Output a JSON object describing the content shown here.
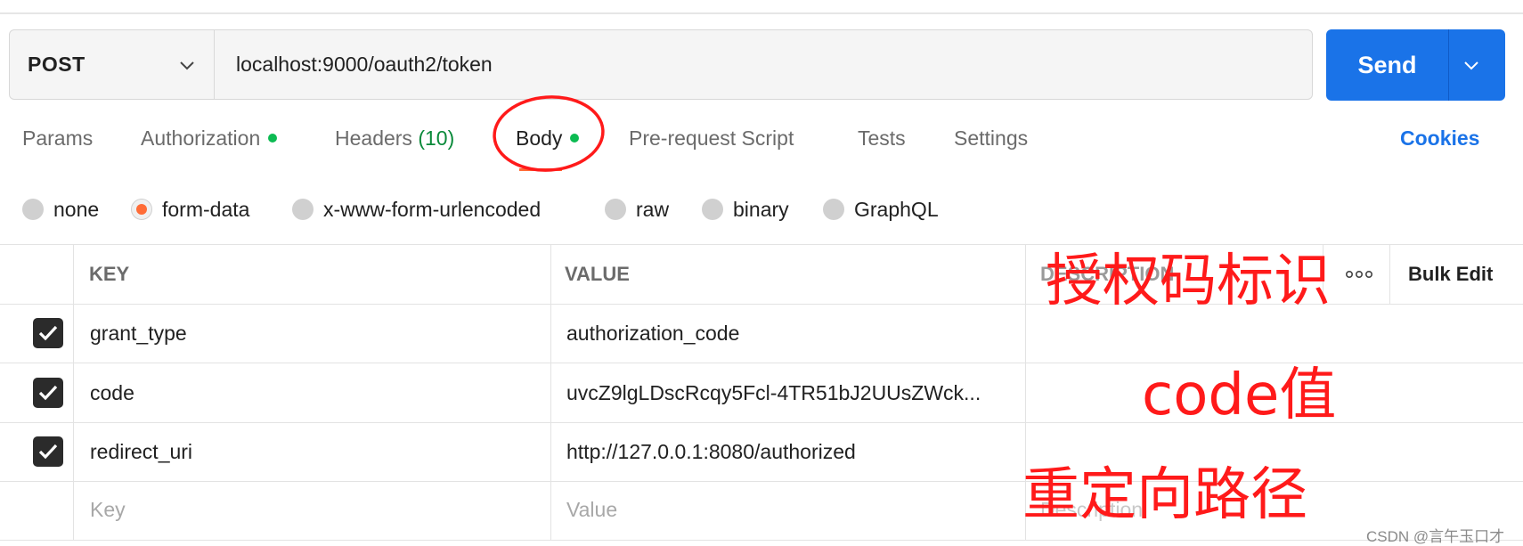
{
  "request": {
    "method": "POST",
    "url": "localhost:9000/oauth2/token",
    "send_label": "Send"
  },
  "tabs": [
    {
      "label": "Params"
    },
    {
      "label": "Authorization",
      "dot": true
    },
    {
      "label": "Headers",
      "count": "(10)"
    },
    {
      "label": "Body",
      "dot": true,
      "active": true
    },
    {
      "label": "Pre-request Script"
    },
    {
      "label": "Tests"
    },
    {
      "label": "Settings"
    }
  ],
  "cookies_label": "Cookies",
  "body_types": [
    {
      "label": "none",
      "selected": false
    },
    {
      "label": "form-data",
      "selected": true
    },
    {
      "label": "x-www-form-urlencoded",
      "selected": false
    },
    {
      "label": "raw",
      "selected": false
    },
    {
      "label": "binary",
      "selected": false
    },
    {
      "label": "GraphQL",
      "selected": false
    }
  ],
  "table": {
    "headers": {
      "key": "KEY",
      "value": "VALUE",
      "description": "DESCRIPTION",
      "bulk_edit": "Bulk Edit"
    },
    "rows": [
      {
        "checked": true,
        "key": "grant_type",
        "value": "authorization_code"
      },
      {
        "checked": true,
        "key": "code",
        "value": "uvcZ9lgLDscRcqy5Fcl-4TR51bJ2UUsZWck..."
      },
      {
        "checked": true,
        "key": "redirect_uri",
        "value": "http://127.0.0.1:8080/authorized"
      }
    ],
    "placeholders": {
      "key": "Key",
      "value": "Value",
      "description": "Description"
    }
  },
  "annotations": {
    "grant_type_note": "授权码标识",
    "code_note": "code值",
    "redirect_note": "重定向路径",
    "color": "#ff1a1a"
  },
  "watermark": "CSDN @言午玉口才",
  "colors": {
    "accent": "#1a73e8",
    "active_tab": "#ff6c37",
    "dot": "#0cbb52"
  }
}
